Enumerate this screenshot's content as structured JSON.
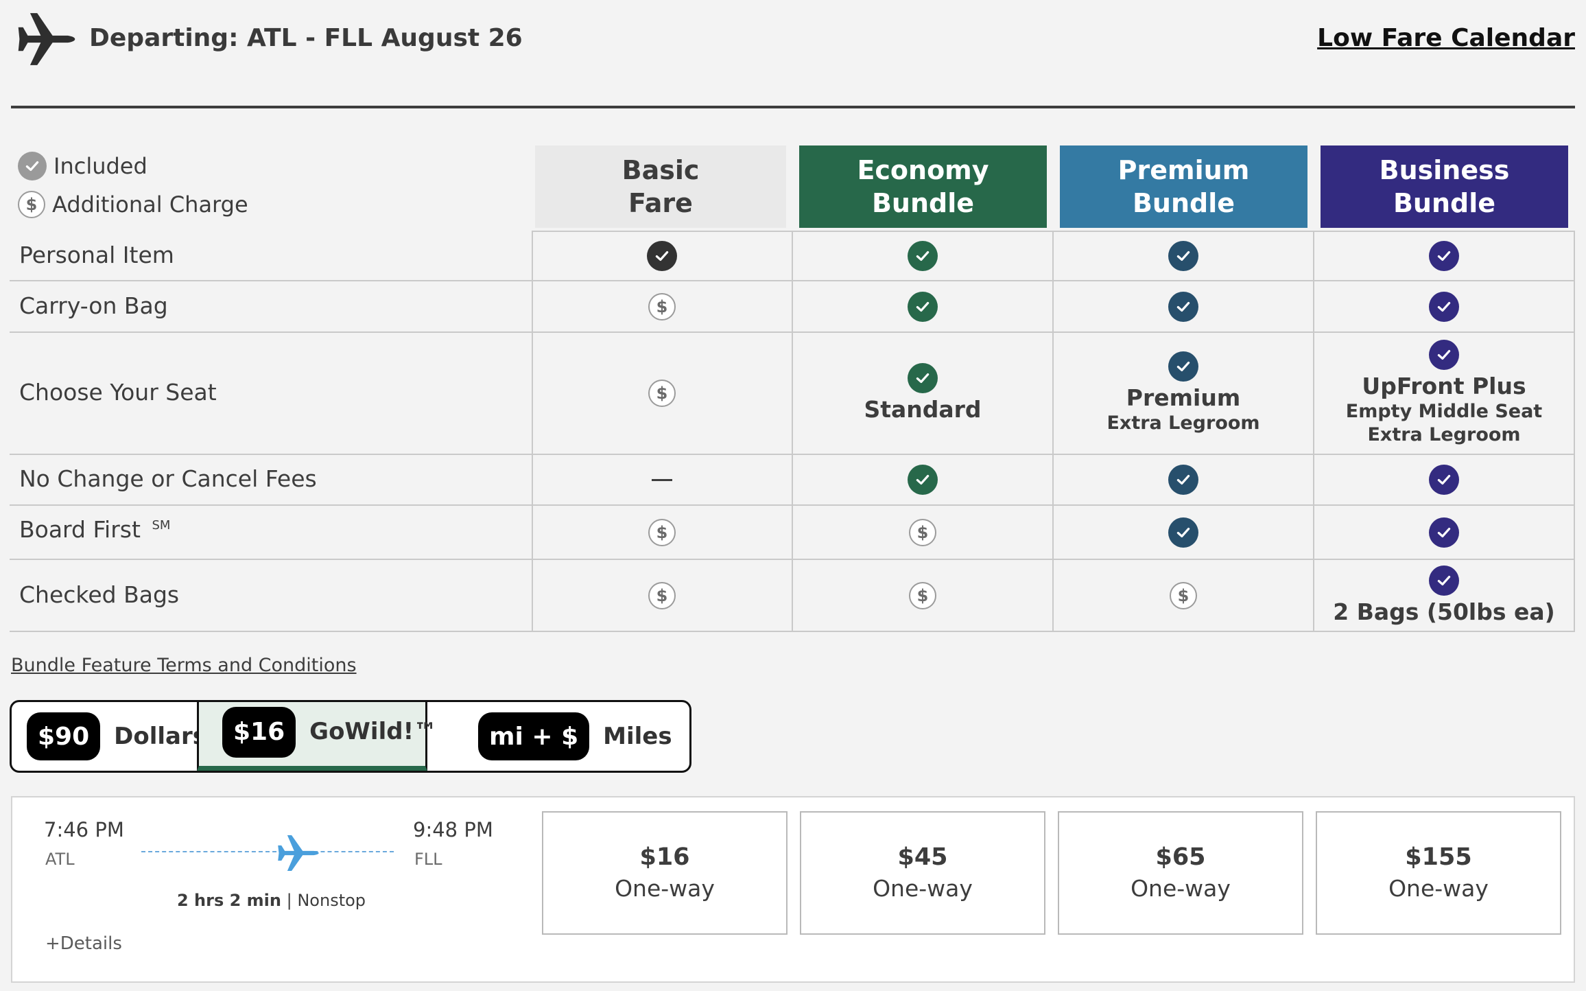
{
  "header": {
    "title": "Departing: ATL - FLL August 26",
    "low_fare_link": "Low Fare Calendar"
  },
  "legend": {
    "included": "Included",
    "additional_charge": "Additional Charge",
    "dollar_symbol": "$"
  },
  "columns": [
    {
      "line1": "Basic",
      "line2": "Fare",
      "color": "#e9e9e9",
      "text_color": "#3d3d3d"
    },
    {
      "line1": "Economy",
      "line2": "Bundle",
      "color": "#27684a",
      "text_color": "#ffffff"
    },
    {
      "line1": "Premium",
      "line2": "Bundle",
      "color": "#347aa3",
      "text_color": "#ffffff"
    },
    {
      "line1": "Business",
      "line2": "Bundle",
      "color": "#332b80",
      "text_color": "#ffffff"
    }
  ],
  "check_colors": [
    "#333333",
    "#27684a",
    "#274f6c",
    "#332b80"
  ],
  "rows": [
    {
      "label": "Personal Item",
      "sup": "",
      "cells": [
        {
          "type": "check"
        },
        {
          "type": "check"
        },
        {
          "type": "check"
        },
        {
          "type": "check"
        }
      ]
    },
    {
      "label": "Carry-on Bag",
      "sup": "",
      "cells": [
        {
          "type": "dollar"
        },
        {
          "type": "check"
        },
        {
          "type": "check"
        },
        {
          "type": "check"
        }
      ]
    },
    {
      "label": "Choose Your Seat",
      "sup": "",
      "cells": [
        {
          "type": "dollar"
        },
        {
          "type": "check",
          "main": "Standard"
        },
        {
          "type": "check",
          "main": "Premium",
          "sub": [
            "Extra Legroom"
          ]
        },
        {
          "type": "check",
          "main": "UpFront Plus",
          "sub": [
            "Empty Middle Seat",
            "Extra Legroom"
          ]
        }
      ]
    },
    {
      "label": "No Change or Cancel Fees",
      "sup": "",
      "cells": [
        {
          "type": "dash"
        },
        {
          "type": "check"
        },
        {
          "type": "check"
        },
        {
          "type": "check"
        }
      ]
    },
    {
      "label": "Board First",
      "sup": "SM",
      "cells": [
        {
          "type": "dollar"
        },
        {
          "type": "dollar"
        },
        {
          "type": "check"
        },
        {
          "type": "check"
        }
      ]
    },
    {
      "label": "Checked Bags",
      "sup": "",
      "cells": [
        {
          "type": "dollar"
        },
        {
          "type": "dollar"
        },
        {
          "type": "dollar"
        },
        {
          "type": "check",
          "main": "2 Bags (50lbs ea)"
        }
      ]
    }
  ],
  "terms_link": "Bundle Feature Terms and Conditions",
  "fare_options": [
    {
      "pill": "$90",
      "label": "Dollars",
      "selected": false
    },
    {
      "pill": "$16",
      "label": "GoWild!™",
      "selected": true
    },
    {
      "pill": "mi + $",
      "label": "Miles",
      "selected": false
    }
  ],
  "flight": {
    "depart_time": "7:46 PM",
    "depart_code": "ATL",
    "arrive_time": "9:48 PM",
    "arrive_code": "FLL",
    "duration": "2 hrs 2 min",
    "separator": " | ",
    "stops": "Nonstop",
    "details_link": "+Details"
  },
  "prices": [
    {
      "amount": "$16",
      "label": "One-way"
    },
    {
      "amount": "$45",
      "label": "One-way"
    },
    {
      "amount": "$65",
      "label": "One-way"
    },
    {
      "amount": "$155",
      "label": "One-way"
    }
  ],
  "accent_plane_color": "#4a9fdc"
}
